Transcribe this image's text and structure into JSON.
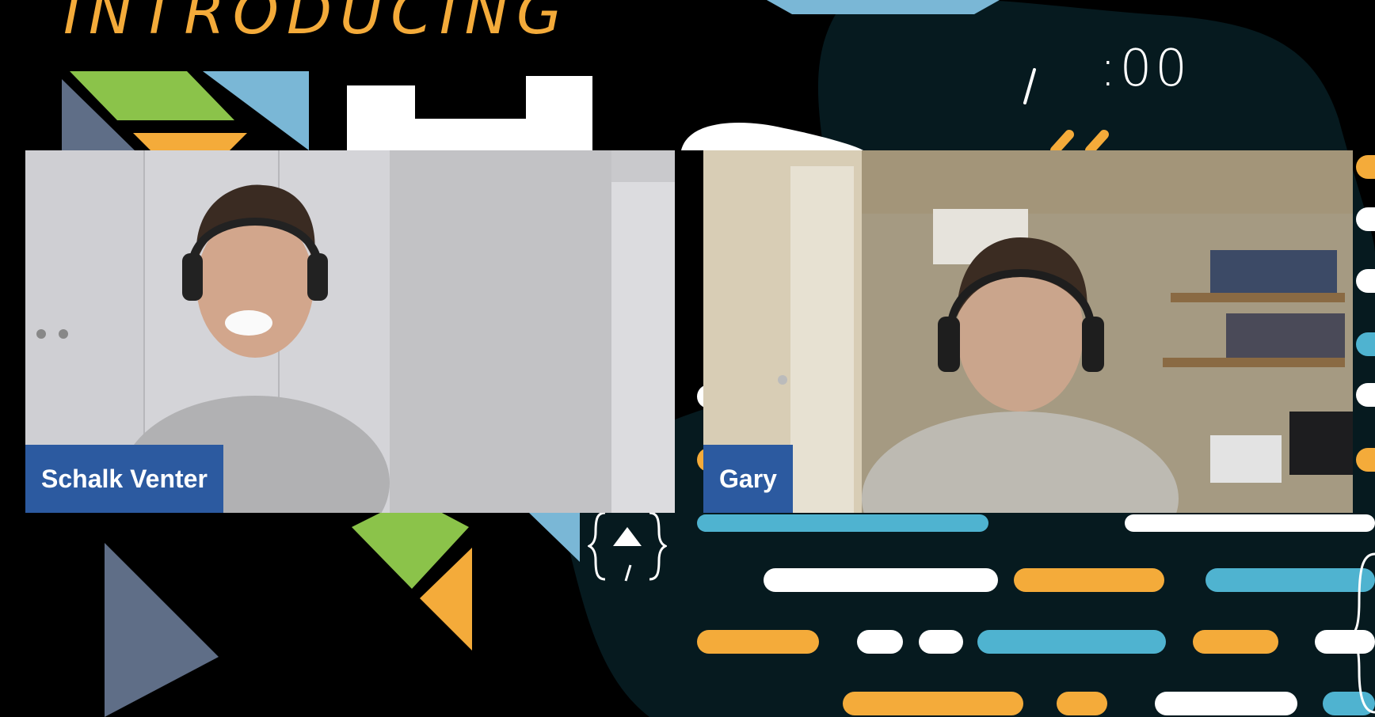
{
  "banner": {
    "intro_text": "INTRODUCING",
    "timer_text": ":00"
  },
  "participants": [
    {
      "name": "Schalk Venter"
    },
    {
      "name": "Gary"
    }
  ],
  "colors": {
    "background": "#000000",
    "blob": "#061a1f",
    "orange": "#f4ab3a",
    "blue": "#4fb3d0",
    "light_blue": "#7ab7d6",
    "green": "#8bc34a",
    "slate": "#5f6e87",
    "name_tag": "#2c5aa0",
    "white": "#ffffff"
  }
}
